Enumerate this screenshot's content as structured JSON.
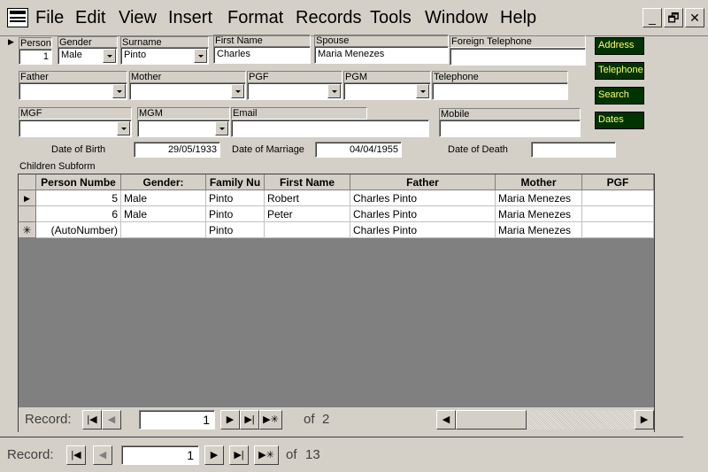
{
  "menu": [
    "File",
    "Edit",
    "View",
    "Insert",
    "Format",
    "Records",
    "Tools",
    "Window",
    "Help"
  ],
  "window_buttons": {
    "minimize": "_",
    "restore": "🗗",
    "close": "✕"
  },
  "fields": {
    "person": {
      "label": "Person",
      "value": "1"
    },
    "gender": {
      "label": "Gender",
      "value": "Male"
    },
    "surname": {
      "label": "Surname",
      "value": "Pinto"
    },
    "first_name": {
      "label": "First Name",
      "value": "Charles"
    },
    "spouse": {
      "label": "Spouse",
      "value": "Maria Menezes"
    },
    "foreign_telephone": {
      "label": "Foreign Telephone",
      "value": ""
    },
    "father": {
      "label": "Father",
      "value": ""
    },
    "mother": {
      "label": "Mother",
      "value": ""
    },
    "pgf": {
      "label": "PGF",
      "value": ""
    },
    "pgm": {
      "label": "PGM",
      "value": ""
    },
    "telephone": {
      "label": "Telephone",
      "value": ""
    },
    "mgf": {
      "label": "MGF",
      "value": ""
    },
    "mgm": {
      "label": "MGM",
      "value": ""
    },
    "email": {
      "label": "Email",
      "value": ""
    },
    "mobile": {
      "label": "Mobile",
      "value": ""
    },
    "date_of_birth": {
      "label": "Date of Birth",
      "value": "29/05/1933"
    },
    "date_of_marriage": {
      "label": "Date of Marriage",
      "value": "04/04/1955"
    },
    "date_of_death": {
      "label": "Date of Death",
      "value": ""
    }
  },
  "side_buttons": [
    "Address",
    "Telephone",
    "Search",
    "Dates"
  ],
  "subform": {
    "label": "Children Subform",
    "columns": [
      "Person Numbe",
      "Gender:",
      "Family Nu",
      "First Name",
      "Father",
      "Mother",
      "PGF"
    ],
    "rows": [
      {
        "selector": "▶",
        "cells": [
          "5",
          "Male",
          "Pinto",
          "Robert",
          "Charles Pinto",
          "Maria Menezes",
          ""
        ]
      },
      {
        "selector": "",
        "cells": [
          "6",
          "Male",
          "Pinto",
          "Peter",
          "Charles Pinto",
          "Maria Menezes",
          ""
        ]
      },
      {
        "selector": "✳",
        "cells": [
          "(AutoNumber)",
          "",
          "Pinto",
          "",
          "Charles Pinto",
          "Maria Menezes",
          ""
        ]
      }
    ],
    "nav": {
      "label": "Record:",
      "current": "1",
      "of_label": "of",
      "total": "2"
    }
  },
  "main_nav": {
    "label": "Record:",
    "current": "1",
    "of_label": "of",
    "total": "13"
  }
}
